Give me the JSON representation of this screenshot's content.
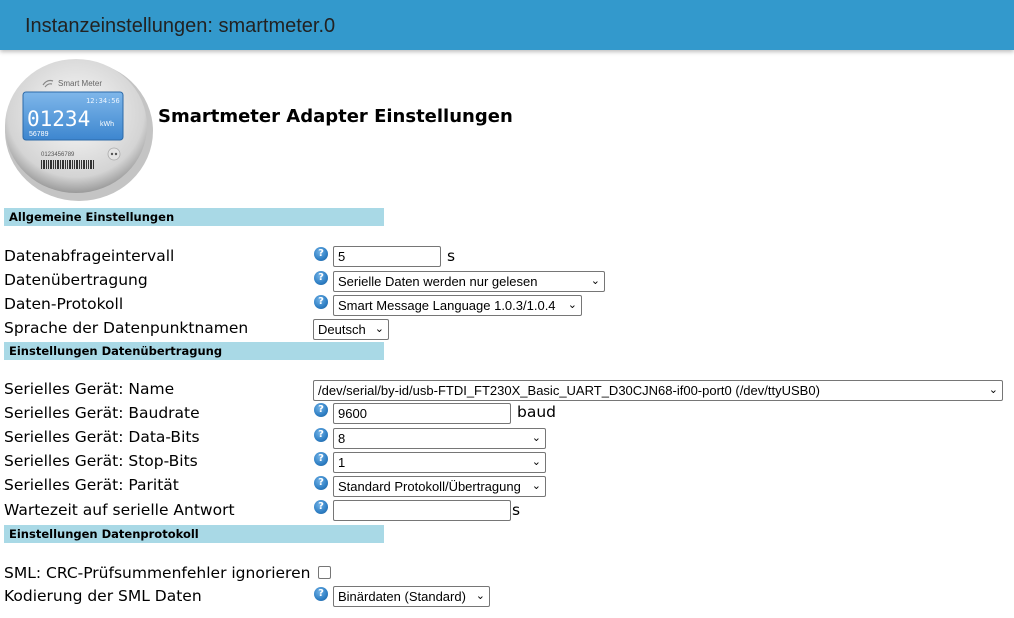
{
  "window": {
    "title": "Instanzeinstellungen: smartmeter.0"
  },
  "logo": {
    "brand": "Smart Meter",
    "time": "12:34:56",
    "reading": "01234",
    "unit": "kWh",
    "sub": "56789",
    "serial": "0123456789"
  },
  "page_title": "Smartmeter Adapter Einstellungen",
  "sections": {
    "general": "Allgemeine Einstellungen",
    "transfer": "Einstellungen Datenübertragung",
    "protocol": "Einstellungen Datenprotokoll"
  },
  "fields": {
    "interval": {
      "label": "Datenabfrageintervall",
      "value": "5",
      "unit": "s"
    },
    "transfer_mode": {
      "label": "Datenübertragung",
      "value": "Serielle Daten werden nur gelesen"
    },
    "protocol": {
      "label": "Daten-Protokoll",
      "value": "Smart Message Language 1.0.3/1.0.4"
    },
    "language": {
      "label": "Sprache der Datenpunktnamen",
      "value": "Deutsch"
    },
    "serial_name": {
      "label": "Serielles Gerät: Name",
      "value": "/dev/serial/by-id/usb-FTDI_FT230X_Basic_UART_D30CJN68-if00-port0 (/dev/ttyUSB0)"
    },
    "baudrate": {
      "label": "Serielles Gerät: Baudrate",
      "value": "9600",
      "unit": "baud"
    },
    "databits": {
      "label": "Serielles Gerät: Data-Bits",
      "value": "8"
    },
    "stopbits": {
      "label": "Serielles Gerät: Stop-Bits",
      "value": "1"
    },
    "parity": {
      "label": "Serielles Gerät: Parität",
      "value": "Standard Protokoll/Übertragung"
    },
    "timeout": {
      "label": "Wartezeit auf serielle Antwort",
      "value": "",
      "unit": "s"
    },
    "crc_ignore": {
      "label": "SML: CRC-Prüfsummenfehler ignorieren",
      "checked": false
    },
    "sml_encoding": {
      "label": "Kodierung der SML Daten",
      "value": "Binärdaten (Standard)"
    }
  },
  "icons": {
    "help": "help-question-icon",
    "dropdown": "chevron-down-icon"
  },
  "colors": {
    "titlebar": "#3399cc",
    "section": "#a9d9e6",
    "help": "#2f7fc4"
  }
}
